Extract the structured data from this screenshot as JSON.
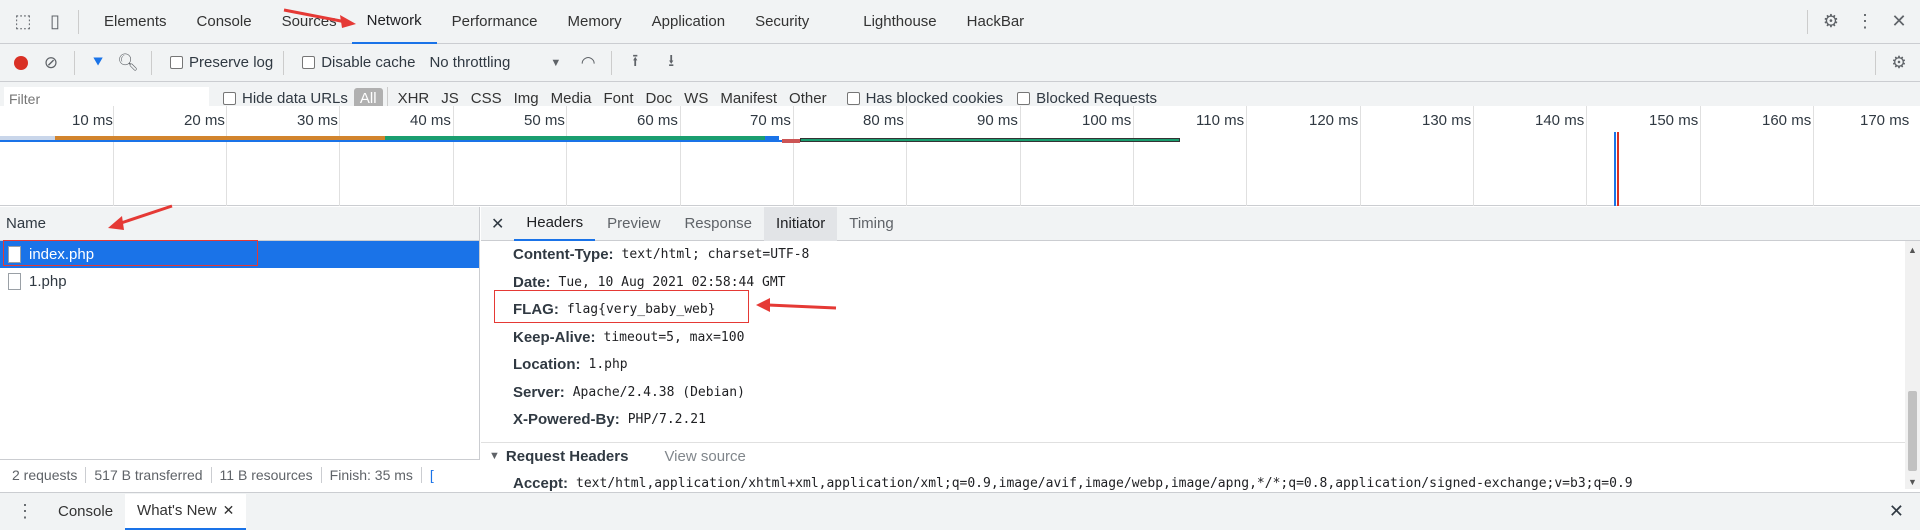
{
  "main_tabs": [
    "Elements",
    "Console",
    "Sources",
    "Network",
    "Performance",
    "Memory",
    "Application",
    "Security",
    "Lighthouse",
    "HackBar"
  ],
  "active_tab": "Network",
  "toolbar": {
    "preserve_log": "Preserve log",
    "disable_cache": "Disable cache",
    "throttling": "No throttling"
  },
  "filterbar": {
    "placeholder": "Filter",
    "hide_data_urls": "Hide data URLs",
    "types": [
      "All",
      "XHR",
      "JS",
      "CSS",
      "Img",
      "Media",
      "Font",
      "Doc",
      "WS",
      "Manifest",
      "Other"
    ],
    "has_blocked_cookies": "Has blocked cookies",
    "blocked_requests": "Blocked Requests"
  },
  "timeline_ticks": [
    "10 ms",
    "20 ms",
    "30 ms",
    "40 ms",
    "50 ms",
    "60 ms",
    "70 ms",
    "80 ms",
    "90 ms",
    "100 ms",
    "110 ms",
    "120 ms",
    "130 ms",
    "140 ms",
    "150 ms",
    "160 ms",
    "170 ms"
  ],
  "requests_header": "Name",
  "requests": [
    {
      "name": "index.php",
      "selected": true
    },
    {
      "name": "1.php",
      "selected": false
    }
  ],
  "status": {
    "requests": "2 requests",
    "transferred": "517 B transferred",
    "resources": "11 B resources",
    "finish": "Finish: 35 ms"
  },
  "detail_tabs": [
    "Headers",
    "Preview",
    "Response",
    "Initiator",
    "Timing"
  ],
  "response_headers": [
    {
      "key": "Content-Type:",
      "value": "text/html; charset=UTF-8"
    },
    {
      "key": "Date:",
      "value": "Tue, 10 Aug 2021 02:58:44 GMT"
    },
    {
      "key": "FLAG:",
      "value": "flag{very_baby_web}"
    },
    {
      "key": "Keep-Alive:",
      "value": "timeout=5, max=100"
    },
    {
      "key": "Location:",
      "value": "1.php"
    },
    {
      "key": "Server:",
      "value": "Apache/2.4.38 (Debian)"
    },
    {
      "key": "X-Powered-By:",
      "value": "PHP/7.2.21"
    }
  ],
  "request_headers": {
    "title": "Request Headers",
    "view_source": "View source",
    "accept_key": "Accept:",
    "accept_value": "text/html,application/xhtml+xml,application/xml;q=0.9,image/avif,image/webp,image/apng,*/*;q=0.8,application/signed-exchange;v=b3;q=0.9"
  },
  "drawer_tabs": [
    "Console",
    "What's New"
  ],
  "colors": {
    "accent": "#1a73e8",
    "annotation": "#e53935",
    "record": "#d93025"
  }
}
